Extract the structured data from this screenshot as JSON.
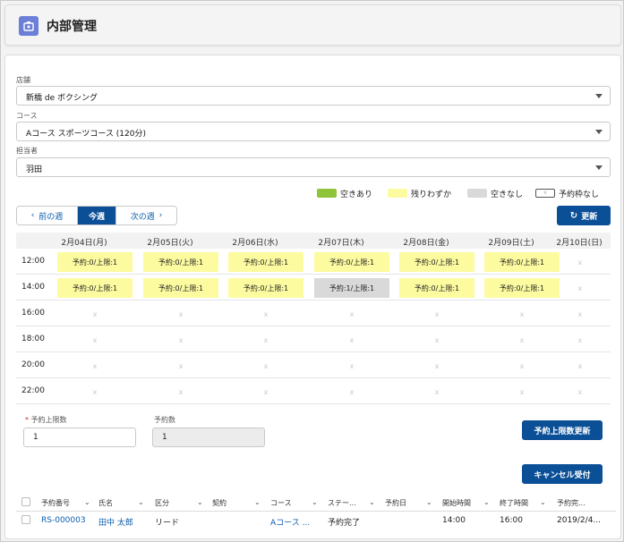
{
  "header": {
    "title": "内部管理"
  },
  "store": {
    "label": "店舗",
    "value": "新橋 de ボクシング"
  },
  "course": {
    "label": "コース",
    "value": "Aコース スポーツコース (120分)"
  },
  "staff": {
    "label": "担当者",
    "value": "羽田"
  },
  "legend": [
    {
      "label": "空きあり",
      "color": "#8fc33a"
    },
    {
      "label": "残りわずか",
      "color": "#fdfba0"
    },
    {
      "label": "空きなし",
      "color": "#d9d9d9"
    },
    {
      "label": "予約枠なし",
      "color": "#ffffff"
    }
  ],
  "week_nav": {
    "prev": "前の週",
    "current": "今週",
    "next": "次の週"
  },
  "refresh_label": "更新",
  "schedule": {
    "days": [
      "2月04日(月)",
      "2月05日(火)",
      "2月06日(水)",
      "2月07日(木)",
      "2月08日(金)",
      "2月09日(土)",
      "2月10日(日)"
    ],
    "rows": [
      {
        "time": "12:00",
        "slots": [
          "予約:0/上限:1",
          "予約:0/上限:1",
          "予約:0/上限:1",
          "予約:0/上限:1",
          "予約:0/上限:1",
          "予約:0/上限:1",
          "x"
        ]
      },
      {
        "time": "14:00",
        "slots": [
          "予約:0/上限:1",
          "予約:0/上限:1",
          "予約:0/上限:1",
          "予約:1/上限:1",
          "予約:0/上限:1",
          "予約:0/上限:1",
          "x"
        ]
      },
      {
        "time": "16:00",
        "slots": [
          "x",
          "x",
          "x",
          "x",
          "x",
          "x",
          "x"
        ]
      },
      {
        "time": "18:00",
        "slots": [
          "x",
          "x",
          "x",
          "x",
          "x",
          "x",
          "x"
        ]
      },
      {
        "time": "20:00",
        "slots": [
          "x",
          "x",
          "x",
          "x",
          "x",
          "x",
          "x"
        ]
      },
      {
        "time": "22:00",
        "slots": [
          "x",
          "x",
          "x",
          "x",
          "x",
          "x",
          "x"
        ]
      }
    ],
    "full_slot": "予約:1/上限:1"
  },
  "limit": {
    "label": "予約上限数",
    "required_mark": "*",
    "value": "1"
  },
  "count": {
    "label": "予約数",
    "value": "1"
  },
  "update_limit_label": "予約上限数更新",
  "cancel_label": "キャンセル受付",
  "table": {
    "columns": [
      "予約番号",
      "氏名",
      "区分",
      "契約",
      "コース",
      "ステー...",
      "予約日",
      "開始時間",
      "終了時間",
      "予約完..."
    ],
    "rows": [
      {
        "id": "RS-000003",
        "name": "田中 太郎",
        "type": "リード",
        "contract": "",
        "course": "Aコース ...",
        "status": "予約完了",
        "date": "",
        "start": "14:00",
        "end": "16:00",
        "done": "2019/2/4..."
      }
    ]
  }
}
